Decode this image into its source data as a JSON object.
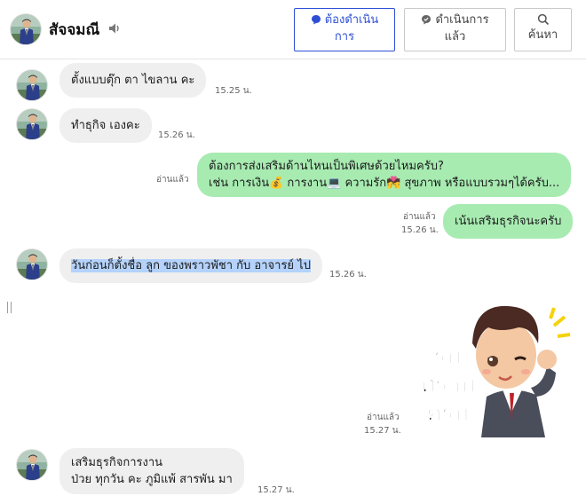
{
  "header": {
    "contact_name": "สัจจมณี",
    "buttons": {
      "todo": [
        "ต้องดำเนิน",
        "การ"
      ],
      "done": [
        "ดำเนินการ",
        "แล้ว"
      ],
      "search": "ค้นหา"
    }
  },
  "messages": [
    {
      "direction": "in",
      "text": "ตั้งแบบตุ๊ก ตา ไขลาน คะ",
      "time": "15.25 น."
    },
    {
      "direction": "in",
      "text": "ทำธุกิจ เองคะ",
      "time": "15.26 น."
    },
    {
      "direction": "out",
      "lines": [
        "ต้องการส่งเสริมด้านไหนเป็นพิเศษด้วยไหมครับ?",
        "เช่น การเงิน💰 การงาน💻 ความรัก💏 สุขภาพ หรือแบบรวมๆได้ครับ..."
      ],
      "read": "อ่านแล้ว",
      "time": ""
    },
    {
      "direction": "out",
      "text": "เน้นเสริมธุรกิจนะครับ",
      "read": "อ่านแล้ว",
      "time": "15.26 น."
    },
    {
      "direction": "in",
      "text": "วันก่อนก็ตั้งชื่อ ลูก ของพราวพัชา กับ อาจารย์ ไป",
      "time": "15.26 น.",
      "highlighted": true
    },
    {
      "direction": "out",
      "type": "sticker",
      "sticker_text": [
        "รับ",
        "ทราบ",
        "ครับ"
      ],
      "read": "อ่านแล้ว",
      "time": "15.27 น."
    },
    {
      "direction": "in",
      "lines": [
        "เสริมธุรกิจการงาน",
        "ป่วย ทุกวัน คะ  ภูมิแพ้  สารพัน มา"
      ],
      "time": "15.27 น."
    }
  ],
  "colors": {
    "accent": "#2d4fd6",
    "incoming_bubble": "#efefef",
    "outgoing_bubble": "#a7ebb1",
    "highlight": "#b4d2fb"
  }
}
